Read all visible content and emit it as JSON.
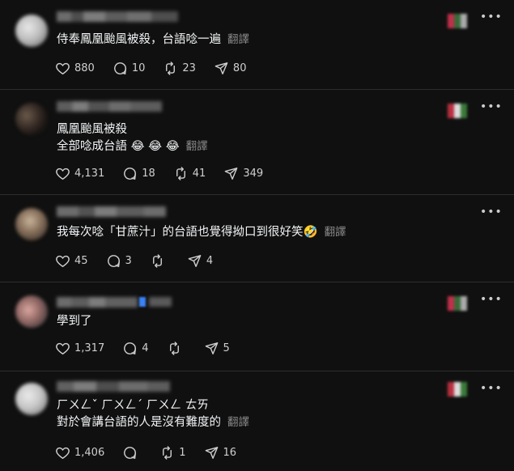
{
  "posts": [
    {
      "text_lines": [
        "侍奉鳳凰颱風被殺，台語唸一遍"
      ],
      "translate": "翻譯",
      "likes": "880",
      "replies": "10",
      "reposts": "23",
      "shares": "80"
    },
    {
      "text_lines": [
        "鳳凰颱風被殺",
        "全部唸成台語 😂 😂 😂"
      ],
      "translate": "翻譯",
      "likes": "4,131",
      "replies": "18",
      "reposts": "41",
      "shares": "349"
    },
    {
      "text_lines": [
        "我每次唸「甘蔗汁」的台語也覺得拗口到很好笑🤣"
      ],
      "translate": "翻譯",
      "likes": "45",
      "replies": "3",
      "reposts": "",
      "shares": "4"
    },
    {
      "text_lines": [
        "學到了"
      ],
      "translate": "",
      "likes": "1,317",
      "replies": "4",
      "reposts": "",
      "shares": "5"
    },
    {
      "text_lines": [
        "ㄏㄨㄥˇ ㄏㄨㄥˊ ㄏㄨㄥ ㄊㄞ",
        "對於會講台語的人是沒有難度的"
      ],
      "translate": "翻譯",
      "likes": "1,406",
      "replies": "",
      "reposts": "1",
      "shares": "16"
    }
  ],
  "icons": {
    "like": "heart-icon",
    "reply": "reply-bubble-icon",
    "repost": "repost-icon",
    "share": "share-send-icon",
    "more": "more-horizontal-icon"
  },
  "colors": {
    "background": "#101010",
    "text": "#f3f5f7",
    "muted": "#8a8a8a",
    "divider": "#2e2e2e"
  }
}
